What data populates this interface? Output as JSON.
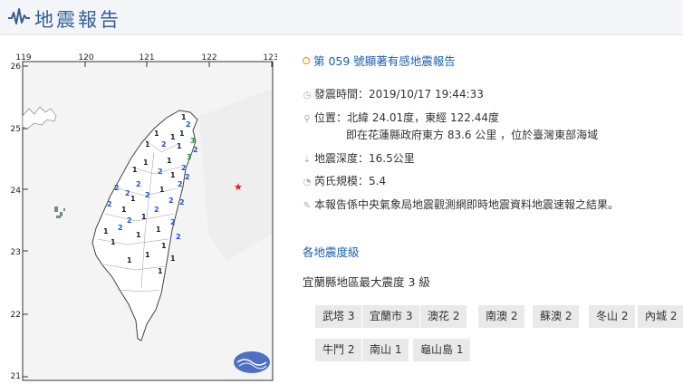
{
  "header": {
    "title": "地震報告"
  },
  "map": {
    "lon_ticks": [
      "119",
      "120",
      "121",
      "122",
      "123"
    ],
    "lat_ticks": [
      "26",
      "25",
      "24",
      "23",
      "22",
      "21"
    ],
    "epicenter_color": "#e01b1b",
    "intensity_color_1": "#222222",
    "intensity_color_2": "#1f4fe0",
    "intensity_color_3": "#188a2e"
  },
  "report": {
    "title": "第 059 號顯著有感地震報告",
    "time_label": "發震時間：",
    "time_value": "2019/10/17 19:44:33",
    "location_label": "位置：",
    "location_line1": "北緯 24.01度，東經 122.44度",
    "location_line2": "即在花蓮縣政府東方 83.6 公里 ，位於臺灣東部海域",
    "depth_label": "地震深度：",
    "depth_value": "16.5公里",
    "magnitude_label": "芮氏規模：",
    "magnitude_value": "5.4",
    "note": "本報告係中央氣象局地震觀測網即時地震資料地震速報之結果。"
  },
  "intensity": {
    "section_title": "各地震度級",
    "max_level": "宜蘭縣地區最大震度 3 級",
    "chips": [
      "武塔 3",
      "宜蘭市 3",
      "澳花 2",
      "南澳 2",
      "蘇澳 2",
      "冬山 2",
      "內城 2",
      "牛鬥 2",
      "南山 1",
      "龜山島 1"
    ]
  }
}
